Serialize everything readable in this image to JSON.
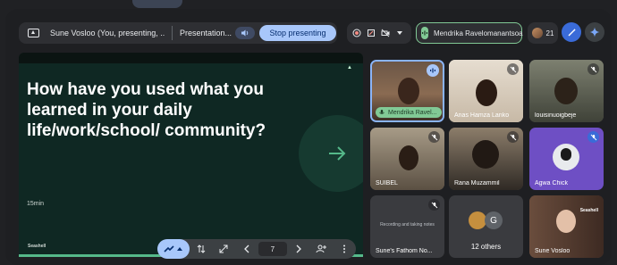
{
  "presenting_bar": {
    "presenter_text": "Sune Vosloo (You, presenting, ...",
    "presentation_label": "Presentation...",
    "stop_label": "Stop presenting"
  },
  "media_controls": {
    "icons": [
      "record-icon",
      "annotate-icon",
      "camera-off-icon",
      "chevron-down-icon"
    ]
  },
  "active_speaker": {
    "name": "Mendrika Ravelomanantsoa"
  },
  "people": {
    "count": "21"
  },
  "slide": {
    "headline": "How have you used what you learned in your daily life/work/school/ community?",
    "duration": "15min",
    "brand": "Seashell"
  },
  "slide_controls": {
    "page": "7"
  },
  "participants": [
    {
      "name": "Mendrika Ravel...",
      "speaking": true
    },
    {
      "name": "Anas Hamza Lanko"
    },
    {
      "name": "louisinuoigbeje"
    },
    {
      "name": "SUIBEL"
    },
    {
      "name": "Rana Muzammil"
    },
    {
      "name": "Agwa Chick"
    },
    {
      "name": "Sune's Fathom No...",
      "caption": "Recording and taking notes"
    },
    {
      "name": "12 others",
      "avatar_letter": "G"
    },
    {
      "name": "Sune Vosloo",
      "overlay": "Seashell"
    }
  ],
  "colors": {
    "accent": "#a8c7fa",
    "speaking": "#81c995",
    "slide_bg": "#0f2823"
  }
}
